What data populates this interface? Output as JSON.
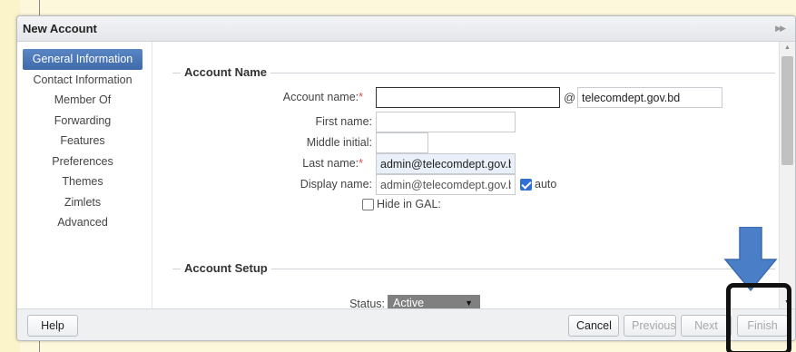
{
  "dialog": {
    "title": "New Account",
    "dock_icon": "dock-right-icon"
  },
  "sidebar": {
    "items": [
      {
        "label": "General Information",
        "active": true
      },
      {
        "label": "Contact Information"
      },
      {
        "label": "Member Of"
      },
      {
        "label": "Forwarding"
      },
      {
        "label": "Features"
      },
      {
        "label": "Preferences"
      },
      {
        "label": "Themes"
      },
      {
        "label": "Zimlets"
      },
      {
        "label": "Advanced"
      }
    ]
  },
  "account_name": {
    "section_title": "Account Name",
    "account_name_label": "Account name:",
    "account_name_value": "",
    "required_mark": "*",
    "at_sign": "@",
    "domain_value": "telecomdept.gov.bd",
    "first_name_label": "First name:",
    "first_name_value": "",
    "middle_initial_label": "Middle initial:",
    "middle_initial_value": "",
    "last_name_label": "Last name:",
    "last_name_value": "admin@telecomdept.gov.bd",
    "display_name_label": "Display name:",
    "display_name_value": "admin@telecomdept.gov.bd",
    "auto_label": "auto",
    "hide_gal_label": "Hide in GAL:"
  },
  "account_setup": {
    "section_title": "Account Setup",
    "status_label": "Status:",
    "status_value": "Active"
  },
  "footer": {
    "help_label": "Help",
    "cancel_label": "Cancel",
    "previous_label": "Previous",
    "next_label": "Next",
    "finish_label": "Finish"
  },
  "colors": {
    "accent": "#3e6aaa",
    "annotation_arrow": "#4a7fc8",
    "annotation_box": "#111111",
    "required": "#d9534f"
  }
}
